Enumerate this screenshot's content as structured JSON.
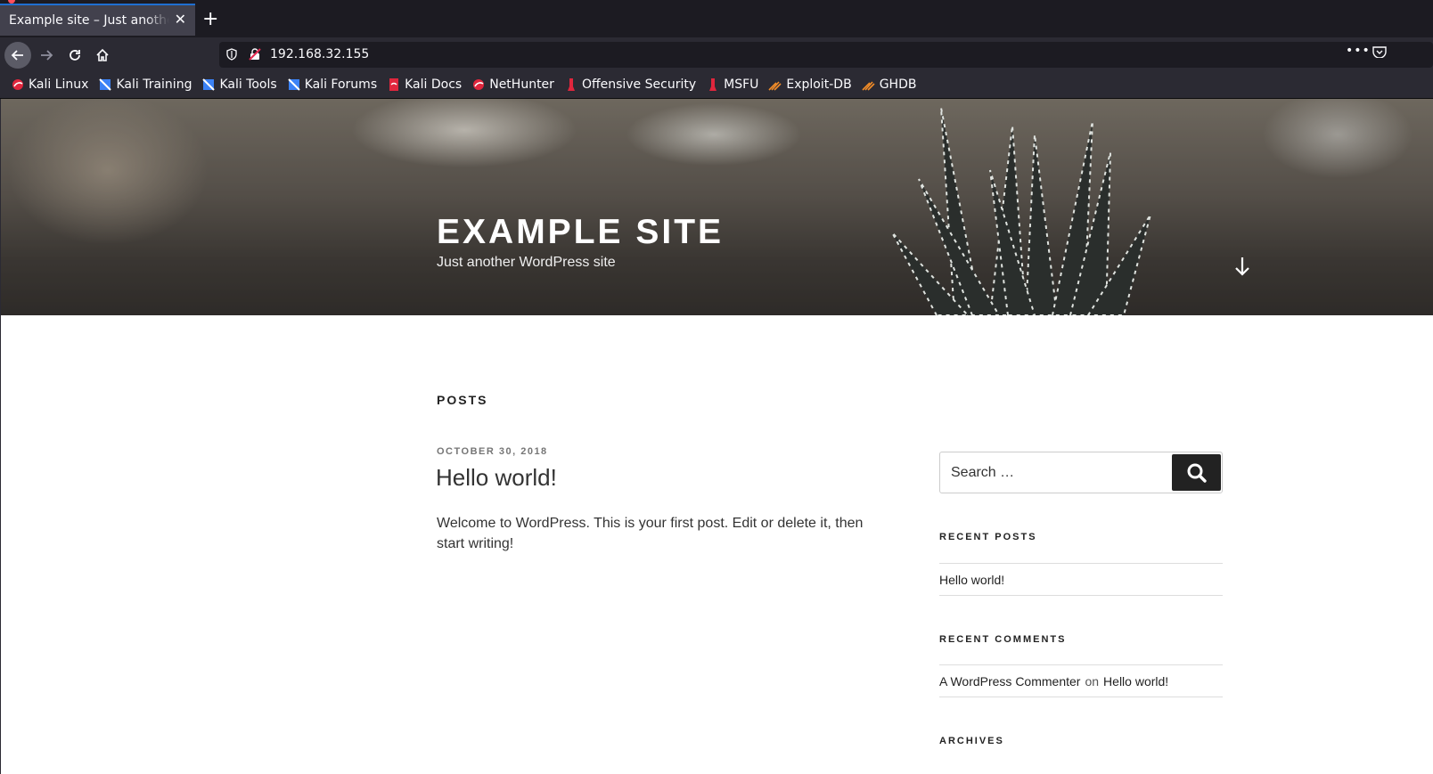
{
  "browser": {
    "tab_title": "Example site – Just another WordPress site",
    "tab_close": "✕",
    "new_tab": "+",
    "url": "192.168.32.155",
    "more_menu": "•••"
  },
  "bookmarks": [
    {
      "label": "Kali Linux",
      "icon": "kali-dragon-icon",
      "color": "#e0263d"
    },
    {
      "label": "Kali Training",
      "icon": "kali-training-icon",
      "color": "#3b82f6"
    },
    {
      "label": "Kali Tools",
      "icon": "kali-tools-icon",
      "color": "#3b82f6"
    },
    {
      "label": "Kali Forums",
      "icon": "kali-forums-icon",
      "color": "#3b82f6"
    },
    {
      "label": "Kali Docs",
      "icon": "kali-docs-icon",
      "color": "#e0263d"
    },
    {
      "label": "NetHunter",
      "icon": "nethunter-icon",
      "color": "#e0263d"
    },
    {
      "label": "Offensive Security",
      "icon": "offsec-icon",
      "color": "#e0263d"
    },
    {
      "label": "MSFU",
      "icon": "msfu-icon",
      "color": "#e0263d"
    },
    {
      "label": "Exploit-DB",
      "icon": "exploit-db-icon",
      "color": "#f28c28"
    },
    {
      "label": "GHDB",
      "icon": "ghdb-icon",
      "color": "#f28c28"
    }
  ],
  "site": {
    "title": "Example site",
    "description": "Just another WordPress site"
  },
  "main": {
    "heading": "Posts",
    "post": {
      "date": "OCTOBER 30, 2018",
      "title": "Hello world!",
      "body": "Welcome to WordPress. This is your first post. Edit or delete it, then start writing!"
    }
  },
  "sidebar": {
    "search_placeholder": "Search …",
    "recent_posts_title": "RECENT POSTS",
    "recent_posts": [
      "Hello world!"
    ],
    "recent_comments_title": "RECENT COMMENTS",
    "recent_comment": {
      "author": "A WordPress Commenter",
      "on": "on",
      "post": "Hello world!"
    },
    "archives_title": "ARCHIVES"
  }
}
